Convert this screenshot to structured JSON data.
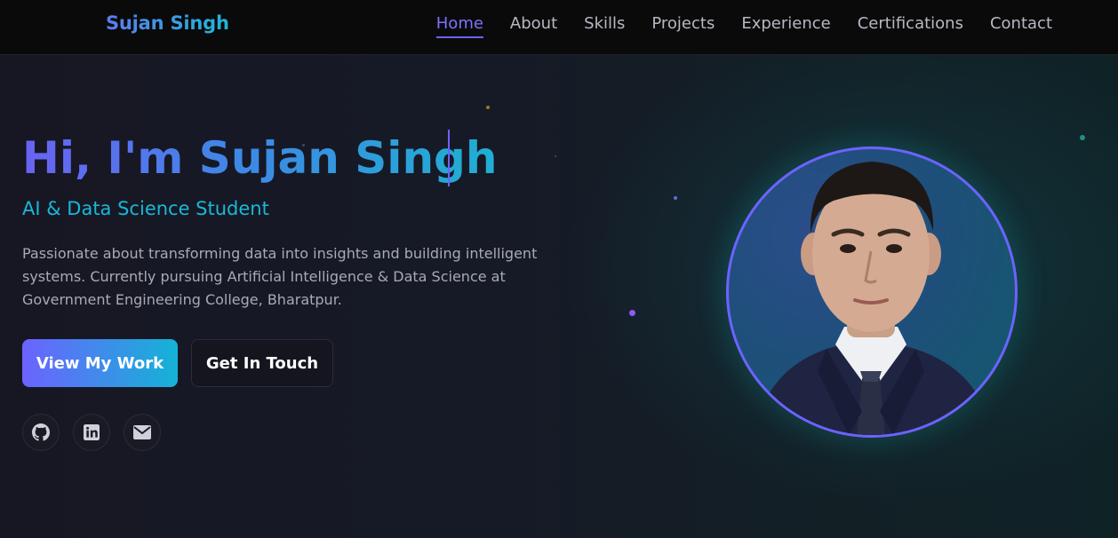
{
  "nav": {
    "brand": "Sujan Singh",
    "links": [
      "Home",
      "About",
      "Skills",
      "Projects",
      "Experience",
      "Certifications",
      "Contact"
    ],
    "active": "Home"
  },
  "hero": {
    "title": "Hi, I'm Sujan Singh",
    "subtitle": "AI & Data Science Student",
    "description": "Passionate about transforming data into insights and building intelligent systems. Currently pursuing Artificial Intelligence & Data Science at Government Engineering College, Bharatpur.",
    "primary_button": "View My Work",
    "secondary_button": "Get In Touch",
    "social": [
      {
        "icon": "github-icon"
      },
      {
        "icon": "linkedin-icon"
      },
      {
        "icon": "envelope-icon"
      }
    ]
  },
  "colors": {
    "accent": "#6c63ff",
    "cyan": "#14b3d6",
    "background": "#13131d"
  }
}
